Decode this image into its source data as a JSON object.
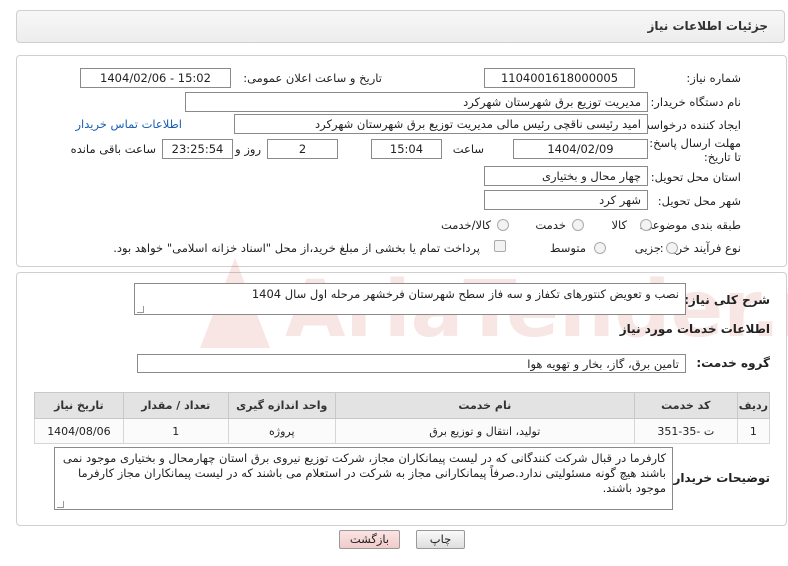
{
  "header": {
    "title": "جزئیات اطلاعات نیاز"
  },
  "fields": {
    "need_number_label": "شماره نیاز:",
    "need_number": "1104001618000005",
    "announce_label": "تاریخ و ساعت اعلان عمومی:",
    "announce_value": "1404/02/06 - 15:02",
    "buyer_org_label": "نام دستگاه خریدار:",
    "buyer_org": "مدیریت توزیع برق شهرستان شهرکرد",
    "requester_label": "ایجاد کننده درخواست:",
    "requester": "امید رئیسی ناقچی رئیس مالی مدیریت توزیع برق شهرستان شهرکرد",
    "contact_link": "اطلاعات تماس خریدار",
    "deadline_label": "مهلت ارسال پاسخ: تا تاریخ:",
    "deadline_date": "1404/02/09",
    "time_label": "ساعت",
    "deadline_time": "15:04",
    "days_value": "2",
    "days_label": "روز و",
    "remaining_time": "23:25:54",
    "remaining_label": "ساعت باقی مانده",
    "province_label": "استان محل تحویل:",
    "province": "چهار محال و بختیاری",
    "city_label": "شهر محل تحویل:",
    "city": "شهر کرد",
    "category_label": "طبقه بندی موضوعی:",
    "category_options": [
      "کالا",
      "خدمت",
      "کالا/خدمت"
    ],
    "process_label": "نوع فرآیند خرید :",
    "process_options": [
      "جزیی",
      "متوسط"
    ],
    "payment_note": "پرداخت تمام یا بخشی از مبلغ خرید،از محل \"اسناد خزانه اسلامی\" خواهد بود."
  },
  "summary": {
    "label": "شرح کلی نیاز:",
    "text": "نصب و تعویض کنتورهای تکفاز و سه فاز سطح شهرستان فرخشهر مرحله اول سال 1404"
  },
  "services": {
    "section_title": "اطلاعات خدمات مورد نیاز",
    "group_label": "گروه خدمت:",
    "group_value": "تامین برق، گاز، بخار و تهویه هوا",
    "columns": [
      "ردیف",
      "کد خدمت",
      "نام خدمت",
      "واحد اندازه گیری",
      "تعداد / مقدار",
      "تاریخ نیاز"
    ],
    "rows": [
      [
        "1",
        "ت -35-351",
        "تولید، انتقال و توزیع برق",
        "پروژه",
        "1",
        "1404/08/06"
      ]
    ]
  },
  "notes": {
    "label": "توضیحات خریدار:",
    "text": "کارفرما در قبال شرکت کنندگانی که در لیست پیمانکاران مجاز، شرکت توزیع نیروی برق استان چهارمحال و بختیاری موجود نمی باشند هیچ گونه مسئولیتی ندارد.صرفاً پیمانکارانی مجاز به شرکت در استعلام می باشند که در لیست پیمانکاران مجاز کارفرما موجود باشند."
  },
  "buttons": {
    "print": "چاپ",
    "back": "بازگشت"
  },
  "watermark": {
    "text": "AriaTender.neT"
  },
  "colors": {
    "link": "#1a5fb4",
    "back_button_bg": "#f6d5d5",
    "watermark": "#c0392b"
  }
}
